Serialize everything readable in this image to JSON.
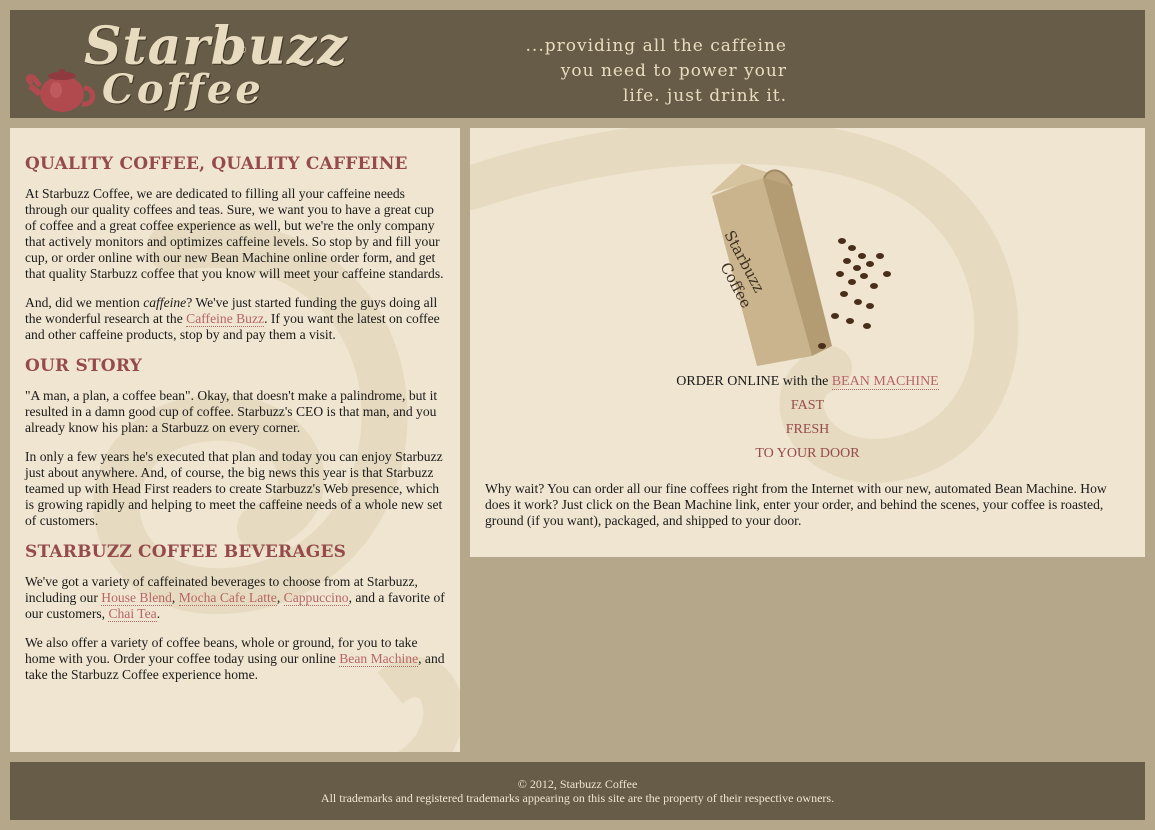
{
  "header": {
    "logo": {
      "word1": "Starbuzz",
      "word2": "Coffee",
      "tm": "®",
      "icon": "teapot-icon"
    },
    "slogan": [
      "...providing all the caffeine",
      "you need to power your",
      "life. just drink it."
    ]
  },
  "main": {
    "section1": {
      "heading": "QUALITY COFFEE, QUALITY CAFFEINE",
      "p1": "At Starbuzz Coffee, we are dedicated to filling all your caffeine needs through our quality coffees and teas. Sure, we want you to have a great cup of coffee and a great coffee experience as well, but we're the only company that actively monitors and optimizes caffeine levels. So stop by and fill your cup, or order online with our new Bean Machine online order form, and get that quality Starbuzz coffee that you know will meet your caffeine standards.",
      "p2_a": "And, did we mention ",
      "p2_em": "caffeine",
      "p2_b": "? We've just started funding the guys doing all the wonderful research at the ",
      "p2_link": "Caffeine Buzz",
      "p2_c": ". If you want the latest on coffee and other caffeine products, stop by and pay them a visit."
    },
    "section2": {
      "heading": "OUR STORY",
      "p1": "\"A man, a plan, a coffee bean\". Okay, that doesn't make a palindrome, but it resulted in a damn good cup of coffee. Starbuzz's CEO is that man, and you already know his plan: a Starbuzz on every corner.",
      "p2": "In only a few years he's executed that plan and today you can enjoy Starbuzz just about anywhere. And, of course, the big news this year is that Starbuzz teamed up with Head First readers to create Starbuzz's Web presence, which is growing rapidly and helping to meet the caffeine needs of a whole new set of customers."
    },
    "section3": {
      "heading": "STARBUZZ COFFEE BEVERAGES",
      "p1_a": "We've got a variety of caffeinated beverages to choose from at Starbuzz, including our ",
      "links": [
        "House Blend",
        "Mocha Cafe Latte",
        "Cappuccino"
      ],
      "sep": ", ",
      "p1_b": ", and a favorite of our customers, ",
      "chai": "Chai Tea",
      "p1_c": ".",
      "p2_a": "We also offer a variety of coffee beans, whole or ground, for you to take home with you. Order your coffee today using our online ",
      "p2_link": "Bean Machine",
      "p2_b": ", and take the Starbuzz Coffee experience home."
    }
  },
  "sidebar": {
    "bag_label_1": "Starbuzz",
    "bag_label_2": "Coffee",
    "order_prefix": "ORDER ONLINE with the ",
    "order_link": "BEAN MACHINE",
    "features": [
      "FAST",
      "FRESH",
      "TO YOUR DOOR"
    ],
    "why": "Why wait? You can order all our fine coffees right from the Internet with our new, automated Bean Machine. How does it work? Just click on the Bean Machine link, enter your order, and behind the scenes, your coffee is roasted, ground (if you want), packaged, and shipped to your door."
  },
  "footer": {
    "copyright": "© 2012, Starbuzz Coffee",
    "trademarks": "All trademarks and registered trademarks appearing on this site are the property of their respective owners."
  },
  "colors": {
    "page_bg": "#b5a789",
    "header_bg": "#675c47",
    "panel_bg": "#efe5d0",
    "heading": "#954b4b",
    "link": "#b76666"
  }
}
